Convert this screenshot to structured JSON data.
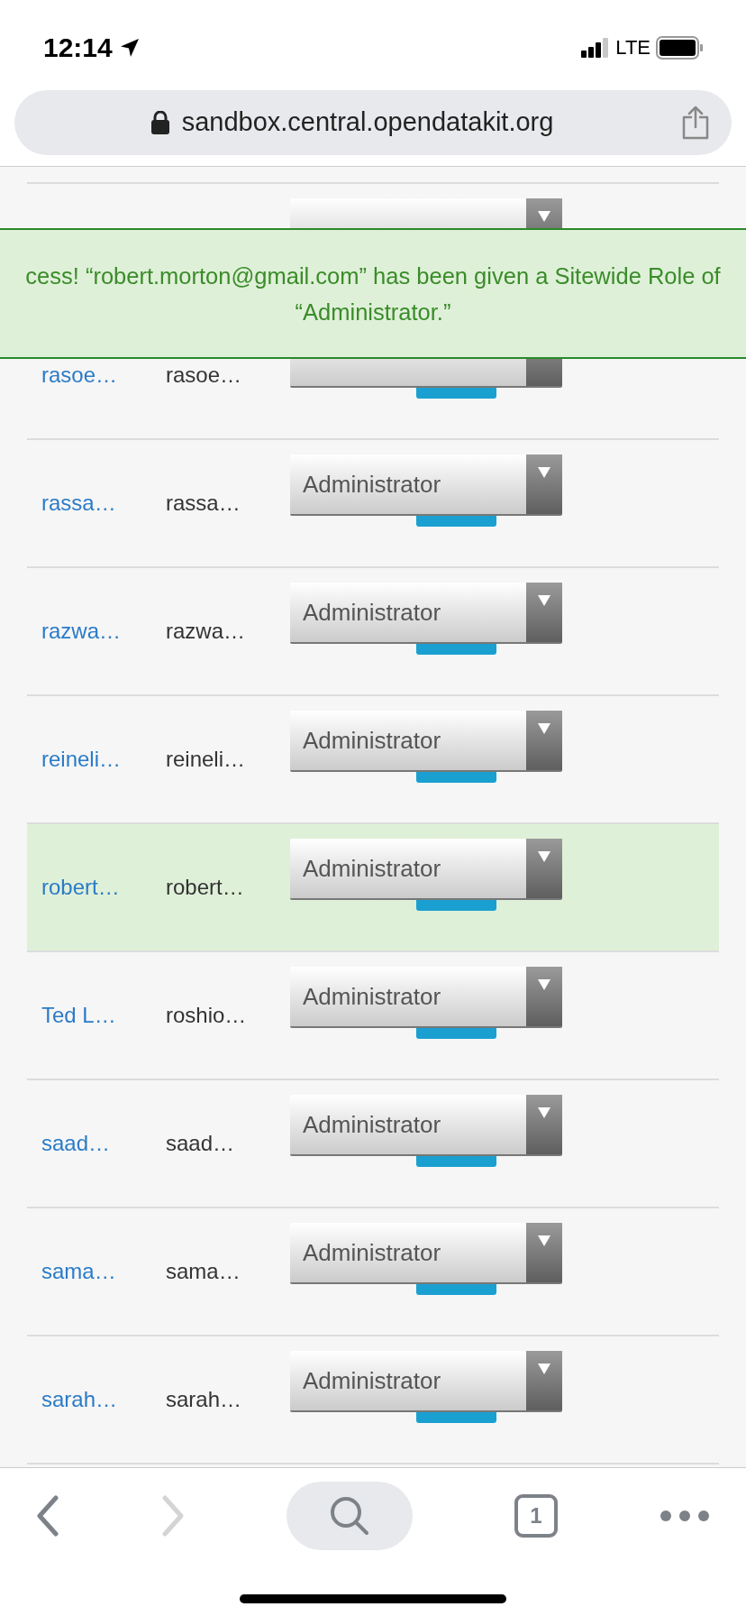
{
  "status_bar": {
    "time": "12:14",
    "network": "LTE"
  },
  "address_bar": {
    "url": "sandbox.central.opendatakit.org"
  },
  "alert": {
    "text": "cess! “robert.morton@gmail.com” has been given a Sitewide Role of “Administrator.”"
  },
  "users": [
    {
      "selected": false
    },
    {
      "name": "rasoe…",
      "email": "rasoe…",
      "selected": false
    },
    {
      "name": "rassa…",
      "email": "rassa…",
      "role": "Administrator",
      "selected": false
    },
    {
      "name": "razwa…",
      "email": "razwa…",
      "role": "Administrator",
      "selected": false
    },
    {
      "name": "reineli…",
      "email": "reineli…",
      "role": "Administrator",
      "selected": false
    },
    {
      "name": "robert…",
      "email": "robert…",
      "role": "Administrator",
      "selected": true
    },
    {
      "name": "Ted L…",
      "email": "roshio…",
      "role": "Administrator",
      "selected": false
    },
    {
      "name": "saad…",
      "email": "saad…",
      "role": "Administrator",
      "selected": false
    },
    {
      "name": "sama…",
      "email": "sama…",
      "role": "Administrator",
      "selected": false
    },
    {
      "name": "sarah…",
      "email": "sarah…",
      "role": "Administrator",
      "selected": false
    }
  ],
  "toolbar": {
    "tab_count": "1"
  }
}
